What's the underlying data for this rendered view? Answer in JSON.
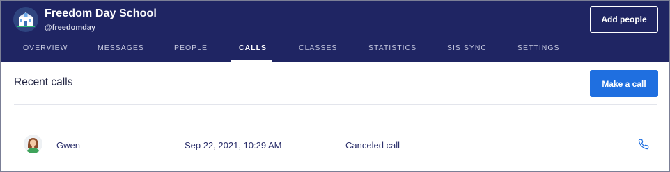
{
  "header": {
    "school_name": "Freedom Day School",
    "handle": "@freedomday",
    "add_people_label": "Add people",
    "logo_icon": "school-building-icon",
    "background_color": "#1f2563"
  },
  "tabs": [
    {
      "label": "OVERVIEW",
      "active": false
    },
    {
      "label": "MESSAGES",
      "active": false
    },
    {
      "label": "PEOPLE",
      "active": false
    },
    {
      "label": "CALLS",
      "active": true
    },
    {
      "label": "CLASSES",
      "active": false
    },
    {
      "label": "STATISTICS",
      "active": false
    },
    {
      "label": "SIS SYNC",
      "active": false
    },
    {
      "label": "SETTINGS",
      "active": false
    }
  ],
  "main": {
    "title": "Recent calls",
    "make_call_label": "Make a call",
    "accent_color": "#1f6fe0",
    "calls": [
      {
        "name": "Gwen",
        "datetime": "Sep 22, 2021, 10:29 AM",
        "status": "Canceled call",
        "avatar_icon": "avatar-woman-icon",
        "action_icon": "phone-icon"
      }
    ]
  }
}
